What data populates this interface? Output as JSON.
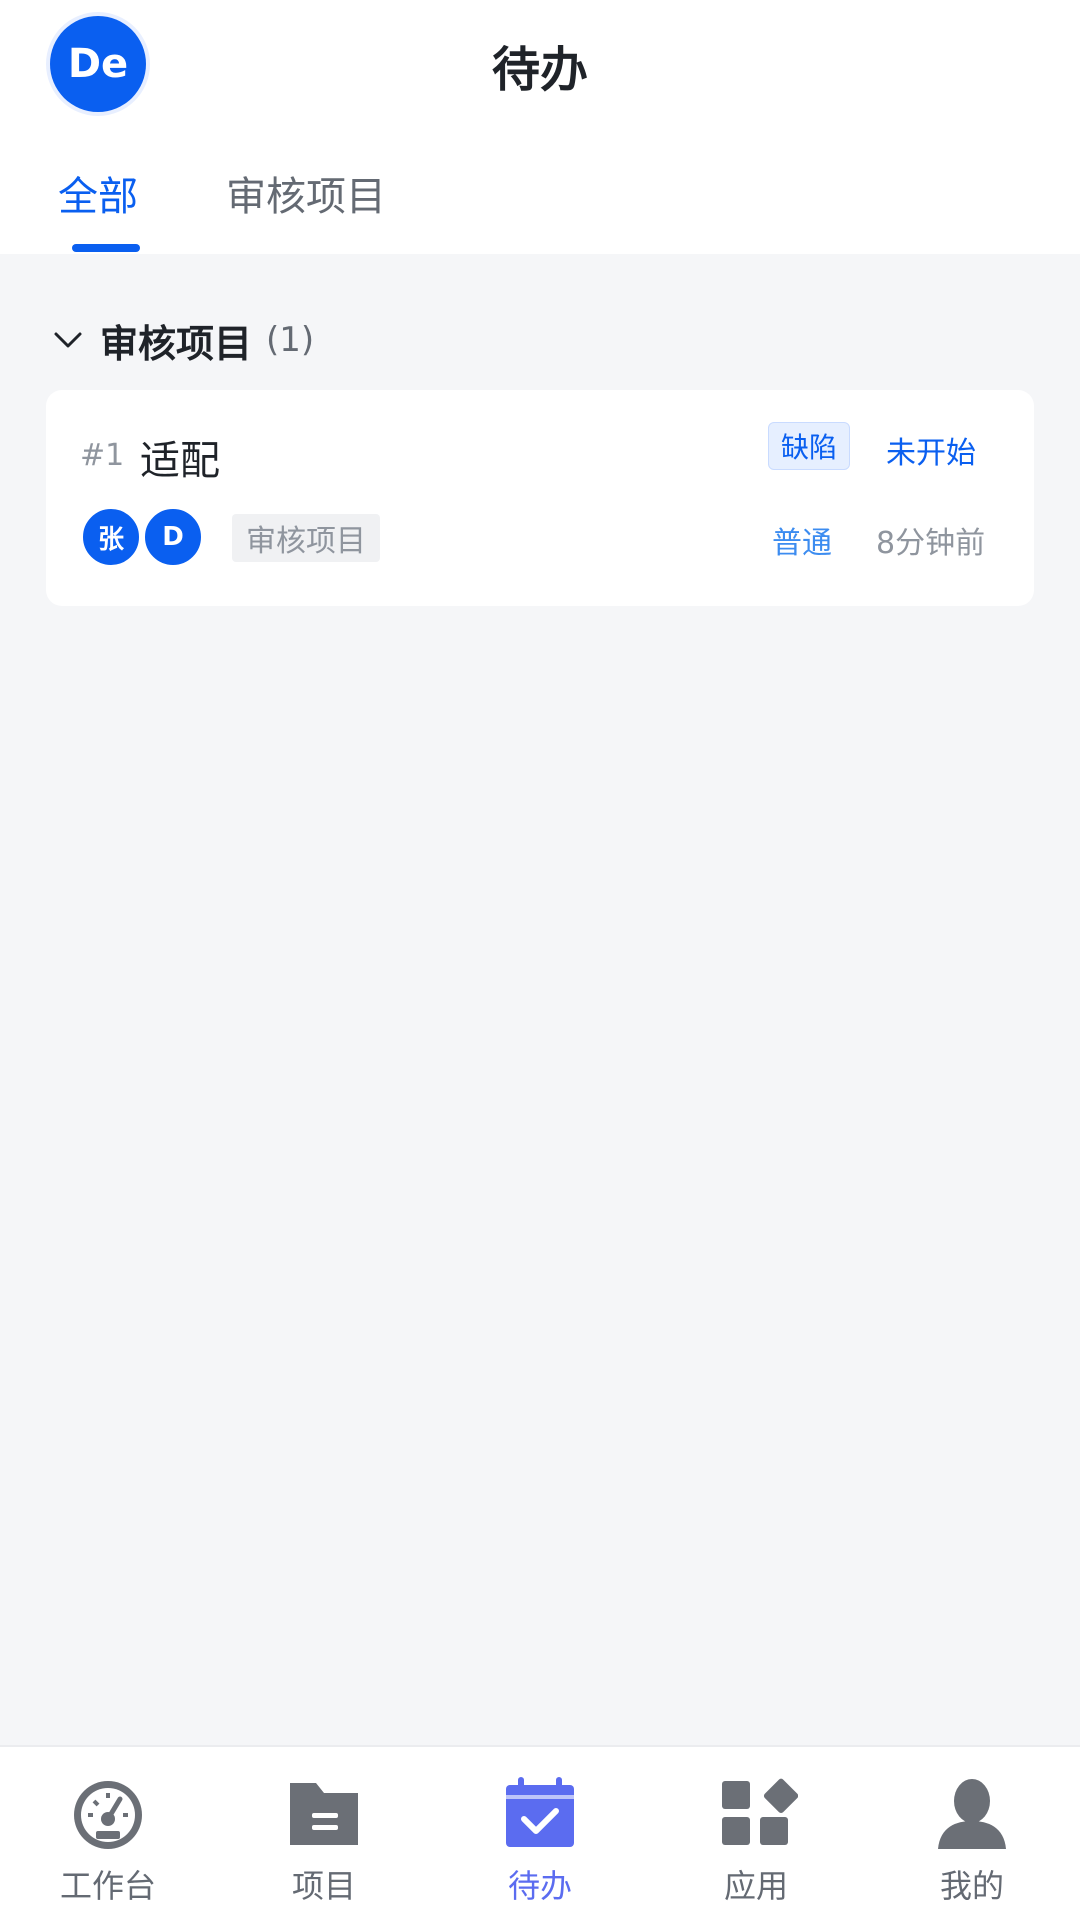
{
  "header": {
    "avatar_initials": "De",
    "title": "待办"
  },
  "tabs": [
    {
      "label": "全部",
      "active": true
    },
    {
      "label": "审核项目",
      "active": false
    }
  ],
  "section": {
    "title": "审核项目",
    "count": "(1)",
    "expanded": true
  },
  "card": {
    "number": "#1",
    "title": "适配",
    "type_tag": "缺陷",
    "status": "未开始",
    "assignees": [
      "张",
      "D"
    ],
    "project": "审核项目",
    "priority": "普通",
    "time": "8分钟前"
  },
  "bottom_nav": [
    {
      "label": "工作台",
      "icon": "dashboard-icon",
      "active": false
    },
    {
      "label": "项目",
      "icon": "folder-icon",
      "active": false
    },
    {
      "label": "待办",
      "icon": "calendar-check-icon",
      "active": true
    },
    {
      "label": "应用",
      "icon": "apps-icon",
      "active": false
    },
    {
      "label": "我的",
      "icon": "user-icon",
      "active": false
    }
  ],
  "colors": {
    "primary": "#0a5ff0",
    "nav_active": "#5b6cf0",
    "nav_inactive": "#6b6f76"
  }
}
